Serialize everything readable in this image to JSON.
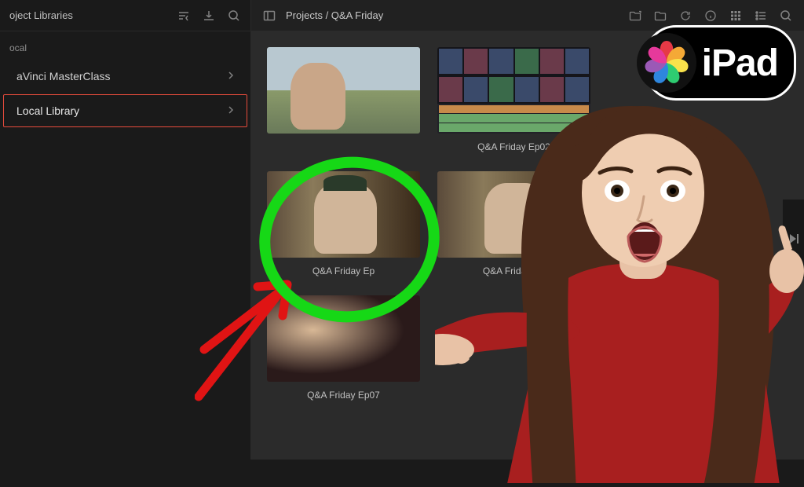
{
  "sidebar": {
    "title": "oject Libraries",
    "section_label": "ocal",
    "items": [
      {
        "label": "aVinci MasterClass",
        "selected": false
      },
      {
        "label": "Local Library",
        "selected": true
      }
    ]
  },
  "header": {
    "breadcrumb": "Projects / Q&A Friday"
  },
  "projects": [
    {
      "title": "",
      "scene": "outdoor"
    },
    {
      "title": "Q&A Friday Ep02",
      "scene": "timeline"
    },
    {
      "title": "",
      "scene": "hidden"
    },
    {
      "title": "Q&A Friday Ep",
      "scene": "indoor-cap"
    },
    {
      "title": "Q&A Friday Ep",
      "scene": "indoor"
    },
    {
      "title": "",
      "scene": "hidden"
    },
    {
      "title": "Q&A Friday Ep07",
      "scene": "dark"
    },
    {
      "title": "",
      "scene": "hidden"
    },
    {
      "title": "",
      "scene": "hidden"
    }
  ],
  "badge": {
    "text": "iPad"
  }
}
